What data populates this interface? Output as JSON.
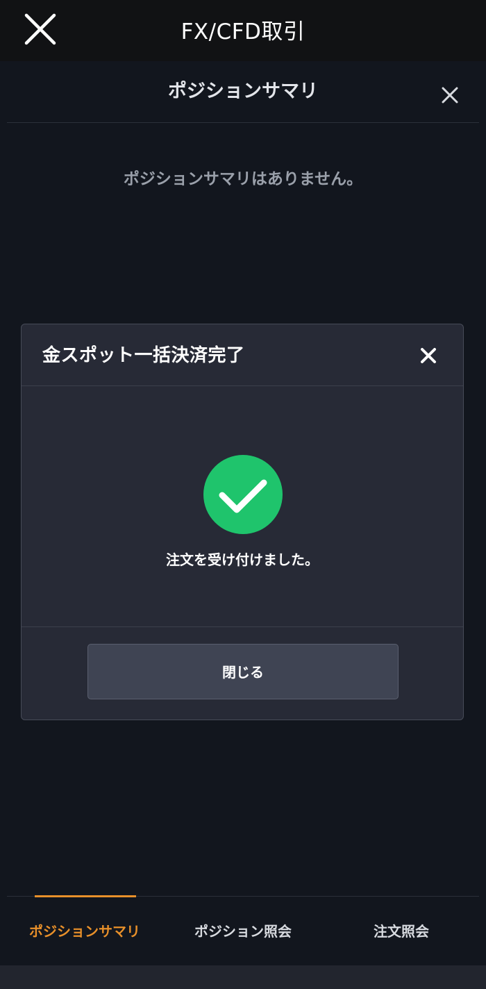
{
  "app_header": {
    "title": "FX/CFD取引",
    "close_icon": "close-icon"
  },
  "panel": {
    "title": "ポジションサマリ",
    "close_icon": "close-icon",
    "empty_message": "ポジションサマリはありません。"
  },
  "dialog": {
    "title": "金スポット一括決済完了",
    "close_icon": "close-icon",
    "status_icon": "check-circle-icon",
    "message": "注文を受け付けました。",
    "button_label": "閉じる"
  },
  "tabs": [
    {
      "label": "ポジションサマリ",
      "active": true
    },
    {
      "label": "ポジション照会",
      "active": false
    },
    {
      "label": "注文照会",
      "active": false
    }
  ],
  "colors": {
    "accent": "#e8902a",
    "success": "#1fc46c",
    "background": "#12161e",
    "dialog_background": "#272a36"
  }
}
